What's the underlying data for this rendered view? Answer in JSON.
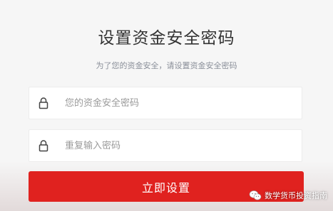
{
  "header": {
    "title": "设置资金安全密码",
    "subtitle": "为了您的资金安全，请设置资金安全密码"
  },
  "form": {
    "password": {
      "placeholder": "您的资金安全密码",
      "icon": "lock-icon"
    },
    "confirm_password": {
      "placeholder": "重复输入密码",
      "icon": "lock-icon"
    },
    "submit_label": "立即设置"
  },
  "watermark": {
    "text": "数学货币投资指南",
    "icon": "wechat-icon"
  },
  "colors": {
    "accent": "#e0221f",
    "title": "#333333",
    "subtitle": "#8a8f99",
    "background": "#f6f6f6"
  }
}
